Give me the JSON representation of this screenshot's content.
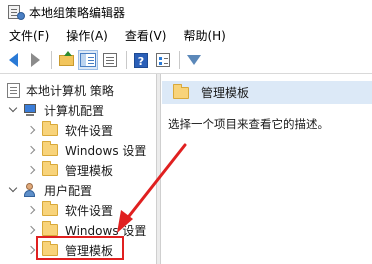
{
  "window": {
    "title": "本地组策略编辑器"
  },
  "menu": [
    {
      "label": "文件(F)"
    },
    {
      "label": "操作(A)"
    },
    {
      "label": "查看(V)"
    },
    {
      "label": "帮助(H)"
    }
  ],
  "toolbar": {
    "buttons": [
      {
        "name": "back-button",
        "icon": "arrow-left-icon"
      },
      {
        "name": "forward-button",
        "icon": "arrow-right-icon"
      },
      {
        "name": "up-folder-button",
        "icon": "folder-up-icon"
      },
      {
        "name": "show-tree-button",
        "icon": "tree-pane-icon"
      },
      {
        "name": "export-list-button",
        "icon": "list-icon"
      },
      {
        "name": "help-button",
        "icon": "help-icon",
        "glyph": "?"
      },
      {
        "name": "properties-button",
        "icon": "properties-icon"
      },
      {
        "name": "filter-button",
        "icon": "filter-icon"
      }
    ]
  },
  "tree": {
    "root": "本地计算机 策略",
    "computer_config": "计算机配置",
    "computer_children": [
      "软件设置",
      "Windows 设置",
      "管理模板"
    ],
    "user_config": "用户配置",
    "user_children": [
      "软件设置",
      "Windows 设置",
      "管理模板"
    ]
  },
  "details": {
    "header": "管理模板",
    "description": "选择一个项目来查看它的描述。"
  },
  "annotation": {
    "color": "#e02020"
  }
}
